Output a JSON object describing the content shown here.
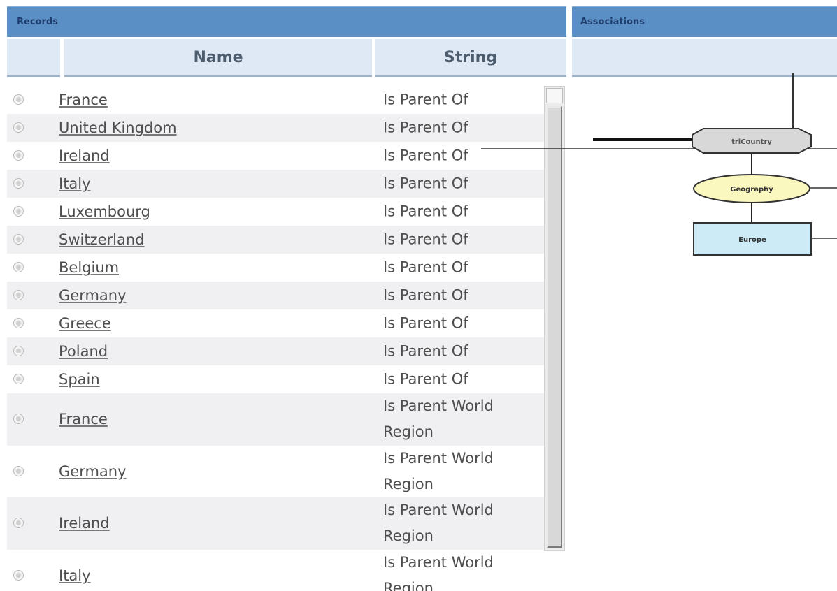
{
  "records": {
    "title": "Records",
    "columns": {
      "name": "Name",
      "string": "String"
    },
    "rows": [
      {
        "name": "France",
        "string": "Is Parent Of"
      },
      {
        "name": "United Kingdom",
        "string": "Is Parent Of"
      },
      {
        "name": "Ireland",
        "string": "Is Parent Of"
      },
      {
        "name": "Italy",
        "string": "Is Parent Of"
      },
      {
        "name": "Luxembourg",
        "string": "Is Parent Of"
      },
      {
        "name": "Switzerland",
        "string": "Is Parent Of"
      },
      {
        "name": "Belgium",
        "string": "Is Parent Of"
      },
      {
        "name": "Germany",
        "string": "Is Parent Of"
      },
      {
        "name": "Greece",
        "string": "Is Parent Of"
      },
      {
        "name": "Poland",
        "string": "Is Parent Of"
      },
      {
        "name": "Spain",
        "string": "Is Parent Of"
      },
      {
        "name": "France",
        "string": "Is Parent World Region"
      },
      {
        "name": "Germany",
        "string": "Is Parent World Region"
      },
      {
        "name": "Ireland",
        "string": "Is Parent World Region"
      },
      {
        "name": "Italy",
        "string": "Is Parent World Region"
      }
    ]
  },
  "associations": {
    "title": "Associations",
    "nodes": {
      "tricountry": "triCountry",
      "geography": "Geography",
      "europe": "Europe"
    }
  },
  "colors": {
    "header": "#5a8fc6",
    "subheader": "#dfe9f5",
    "tricountry_fill": "#d8d8d8",
    "geography_fill": "#fbf8bf",
    "europe_fill": "#cdebf6"
  }
}
